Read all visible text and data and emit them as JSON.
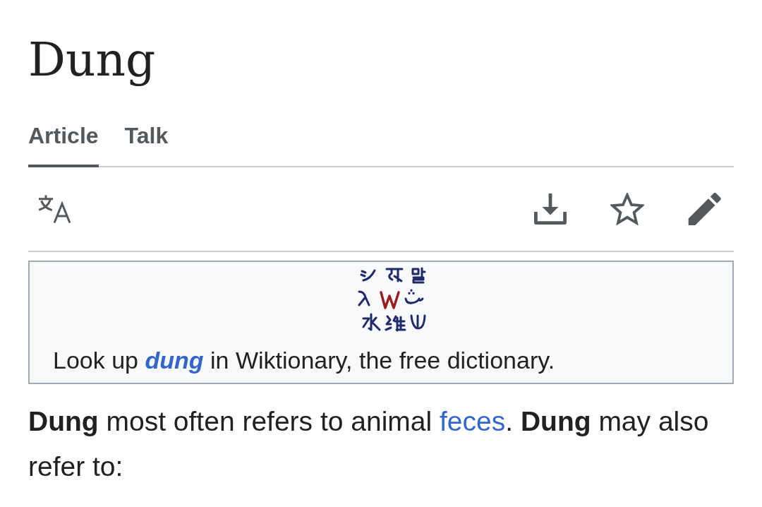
{
  "title": "Dung",
  "tabs": [
    {
      "label": "Article",
      "selected": true
    },
    {
      "label": "Talk",
      "selected": false
    }
  ],
  "wiktionary_box": {
    "text_before": "Look up ",
    "term": "dung",
    "text_after": " in Wiktionary, the free dictionary."
  },
  "intro": [
    {
      "kind": "text",
      "text": "**Dung** most often refers to animal "
    },
    {
      "kind": "link",
      "text": "feces"
    },
    {
      "kind": "text",
      "text": ". **Dung** may also refer to:"
    }
  ]
}
